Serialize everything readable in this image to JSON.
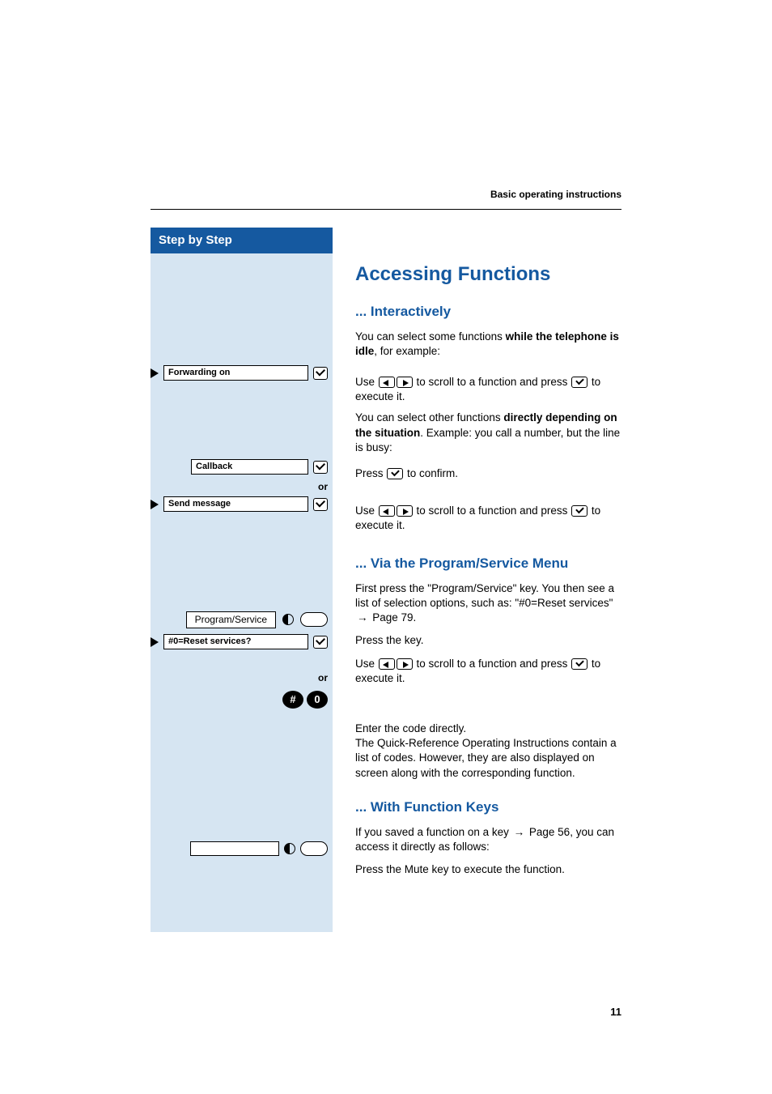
{
  "header": {
    "running": "Basic operating instructions"
  },
  "sidebar": {
    "title": "Step by Step",
    "rows": {
      "forwarding": "Forwarding on",
      "callback": "Callback",
      "send_message": "Send message",
      "program_service": "Program/Service",
      "reset": "#0=Reset services?",
      "or": "or"
    }
  },
  "main": {
    "h1": "Accessing Functions",
    "s1": {
      "title": "... Interactively",
      "p1a": "You can select some functions ",
      "p1b": "while the telephone is idle",
      "p1c": ", for example:",
      "useA": "Use ",
      "useB": " to scroll to a function and press ",
      "useC": " to execute it.",
      "p2a": "You can select other functions ",
      "p2b": "directly depending on the situation",
      "p2c": ". Example:  you call a number, but the line is busy:",
      "pressA": "Press ",
      "pressB": " to confirm."
    },
    "s2": {
      "title": "... Via the Program/Service Menu",
      "p1": "First press the \"Program/Service\" key. You then see a list of selection options, such as: \"#0=Reset services\" ",
      "pageref": "Page 79.",
      "presskey": "Press the key.",
      "codeA": "Enter the code directly.",
      "codeB": "The Quick-Reference Operating Instructions contain a list of codes. However, they are also displayed on screen along with the corresponding function."
    },
    "s3": {
      "title": "... With Function Keys",
      "p1a": "If you saved a function on a key ",
      "p1ref": "Page 56",
      "p1b": ", you can access it directly as follows:",
      "mute": "Press the Mute key to execute the function."
    }
  },
  "footer": {
    "page": "11"
  }
}
